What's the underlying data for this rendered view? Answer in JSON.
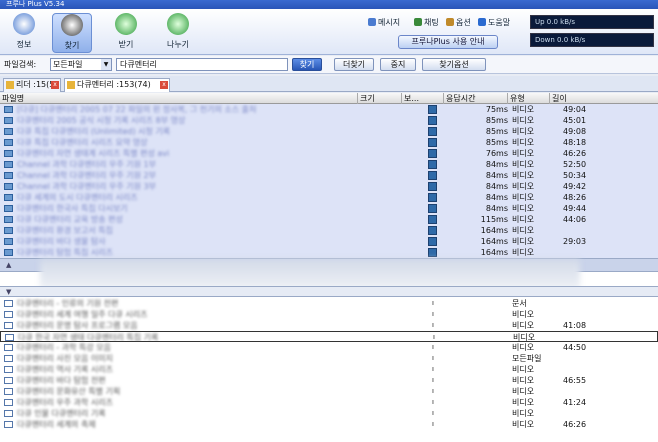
{
  "window": {
    "title": "프루나 Plus V5.34"
  },
  "toolbar": {
    "nav": [
      {
        "label": "정보",
        "icon": "info-icon"
      },
      {
        "label": "찾기",
        "icon": "find-icon"
      },
      {
        "label": "받기",
        "icon": "download-icon"
      },
      {
        "label": "나누기",
        "icon": "share-icon"
      }
    ],
    "links": [
      {
        "label": "메시지",
        "icon": "message-icon"
      },
      {
        "label": "채팅",
        "icon": "chat-icon"
      },
      {
        "label": "옵션",
        "icon": "options-icon"
      },
      {
        "label": "도움말",
        "icon": "help-icon"
      }
    ],
    "main_button": "프루나Plus 사용 안내",
    "up_speed": "Up 0.0 kB/s",
    "down_speed": "Down 0.0 kB/s"
  },
  "search": {
    "label": "파일검색:",
    "type_value": "모든파일",
    "query": "다큐멘터리",
    "search_btn": "찾기",
    "more_btn": "더찾기",
    "stop_btn": "중지",
    "options_btn": "찾기옵션"
  },
  "tabs": [
    {
      "label": "리더 :15(5)"
    },
    {
      "label": "다큐멘터리 :153(74)"
    }
  ],
  "columns": {
    "name": "파일명",
    "size": "크기",
    "status": "보...",
    "speed": "응답시간",
    "type": "유형",
    "length": "길이"
  },
  "rows_top": [
    {
      "name": "[다큐] 다큐멘터리 2005 07 22 파일의 왼 정사복, 그 천기의 소스 출처",
      "speed": "75ms",
      "type": "비디오",
      "length": "49:04"
    },
    {
      "name": "다큐멘터리 2005 공식 시청 기록 시리즈 8부 영상",
      "speed": "85ms",
      "type": "비디오",
      "length": "45:01"
    },
    {
      "name": "다큐 특집 다큐멘터리 (Unlimited) 시청 기록",
      "speed": "85ms",
      "type": "비디오",
      "length": "49:08"
    },
    {
      "name": "다큐 특집 다큐멘터리 시리즈 요약 영상",
      "speed": "85ms",
      "type": "비디오",
      "length": "48:18"
    },
    {
      "name": "다큐멘터리 자연 생태계 시리즈 특별 편성 avi",
      "speed": "76ms",
      "type": "비디오",
      "length": "46:26"
    },
    {
      "name": "Channel 과학 다큐멘터리 우주 기원 1부",
      "speed": "84ms",
      "type": "비디오",
      "length": "52:50"
    },
    {
      "name": "Channel 과학 다큐멘터리 우주 기원 2부",
      "speed": "84ms",
      "type": "비디오",
      "length": "50:34"
    },
    {
      "name": "Channel 과학 다큐멘터리 우주 기원 3부",
      "speed": "84ms",
      "type": "비디오",
      "length": "49:42"
    },
    {
      "name": "다큐 세계의 도시 다큐멘터리 시리즈",
      "speed": "84ms",
      "type": "비디오",
      "length": "48:26"
    },
    {
      "name": "다큐멘터리 한국사 특집 다시보기",
      "speed": "84ms",
      "type": "비디오",
      "length": "49:44"
    },
    {
      "name": "다큐 다큐멘터리 교육 방송 편성",
      "speed": "115ms",
      "type": "비디오",
      "length": "44:06"
    },
    {
      "name": "다큐멘터리 환경 보고서 특집",
      "speed": "164ms",
      "type": "비디오",
      "length": ""
    },
    {
      "name": "다큐멘터리 바다 생물 탐사",
      "speed": "164ms",
      "type": "비디오",
      "length": "29:03"
    },
    {
      "name": "다큐멘터리 탐험 특집 시리즈",
      "speed": "164ms",
      "type": "비디오",
      "length": ""
    }
  ],
  "rows_bottom": [
    {
      "name": "다큐멘터리 - 인류의 기원 전편",
      "type": "문서",
      "length": ""
    },
    {
      "name": "다큐멘터리 세계 여행 일주 다큐 시리즈",
      "type": "비디오",
      "length": ""
    },
    {
      "name": "다큐멘터리 문명 탐사 프로그램 모음",
      "type": "비디오",
      "length": "41:08"
    },
    {
      "name": "다큐 한국 자연 생태 다큐멘터리 특집 기록",
      "type": "비디오",
      "length": ""
    },
    {
      "name": "다큐멘터리 - 과학 특강 모음",
      "type": "비디오",
      "length": "44:50"
    },
    {
      "name": "다큐멘터리 사진 모음 이미지",
      "type": "모든파일",
      "length": ""
    },
    {
      "name": "다큐멘터리 역사 기록 시리즈",
      "type": "비디오",
      "length": ""
    },
    {
      "name": "다큐멘터리 바다 탐험 전편",
      "type": "비디오",
      "length": "46:55"
    },
    {
      "name": "다큐멘터리 문화유산 특별 기획",
      "type": "비디오",
      "length": ""
    },
    {
      "name": "다큐멘터리 우주 과학 시리즈",
      "type": "비디오",
      "length": "41:24"
    },
    {
      "name": "다큐 인물 다큐멘터리 기록",
      "type": "비디오",
      "length": ""
    },
    {
      "name": "다큐멘터리 세계의 축제",
      "type": "비디오",
      "length": "46:26"
    }
  ]
}
